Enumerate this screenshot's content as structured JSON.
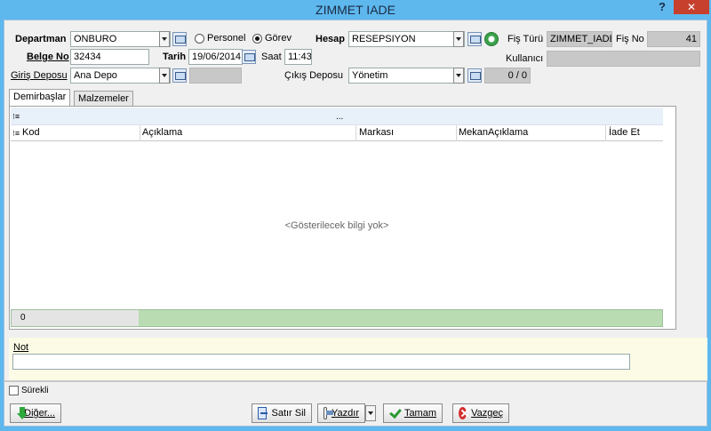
{
  "window": {
    "title": "ZIMMET IADE",
    "help_label": "?",
    "close_label": "✕"
  },
  "header": {
    "departman_label": "Departman",
    "departman_value": "ONBURO",
    "radio_personel": "Personel",
    "radio_gorev": "Görev",
    "selected_radio": "Görev",
    "hesap_label": "Hesap",
    "hesap_value": "RESEPSIYON",
    "fis_turu_label": "Fiş Türü",
    "fis_turu_value": "ZIMMET_IADE",
    "fis_no_label": "Fiş No",
    "fis_no_value": "41",
    "belge_no_label": "Belge No",
    "belge_no_value": "32434",
    "tarih_label": "Tarih",
    "tarih_value": "19/06/2014",
    "saat_label": "Saat",
    "saat_value": "11:43",
    "kullanici_label": "Kullanıcı",
    "kullanici_value": "",
    "giris_deposu_label": "Giriş Deposu",
    "giris_deposu_value": "Ana Depo",
    "cikis_deposu_label": "Çıkış Deposu",
    "cikis_deposu_value": "Yönetim",
    "cikis_count": "0 / 0"
  },
  "tabs": [
    {
      "label": "Demirbaşlar",
      "active": true
    },
    {
      "label": "Malzemeler",
      "active": false
    }
  ],
  "grid": {
    "group_panel_text": "...",
    "columns": [
      "Kod",
      "Açıklama",
      "Markası",
      "MekanAçıklama",
      "İade Et"
    ],
    "empty_message": "<Gösterilecek bilgi yok>",
    "footer_count": "0"
  },
  "note": {
    "label": "Not",
    "value": ""
  },
  "bottom": {
    "surekli_label": "Sürekli",
    "surekli_checked": false,
    "diger_label": "Diğer...",
    "satir_sil_label": "Satır Sil",
    "yazdir_label": "Yazdır",
    "tamam_label": "Tamam",
    "vazgec_label": "Vazgeç"
  },
  "colors": {
    "title_bar": "#5eb8ee",
    "close_button": "#c7402e",
    "grid_footer": "#b9dcb2",
    "note_bg": "#fbfbe6"
  }
}
